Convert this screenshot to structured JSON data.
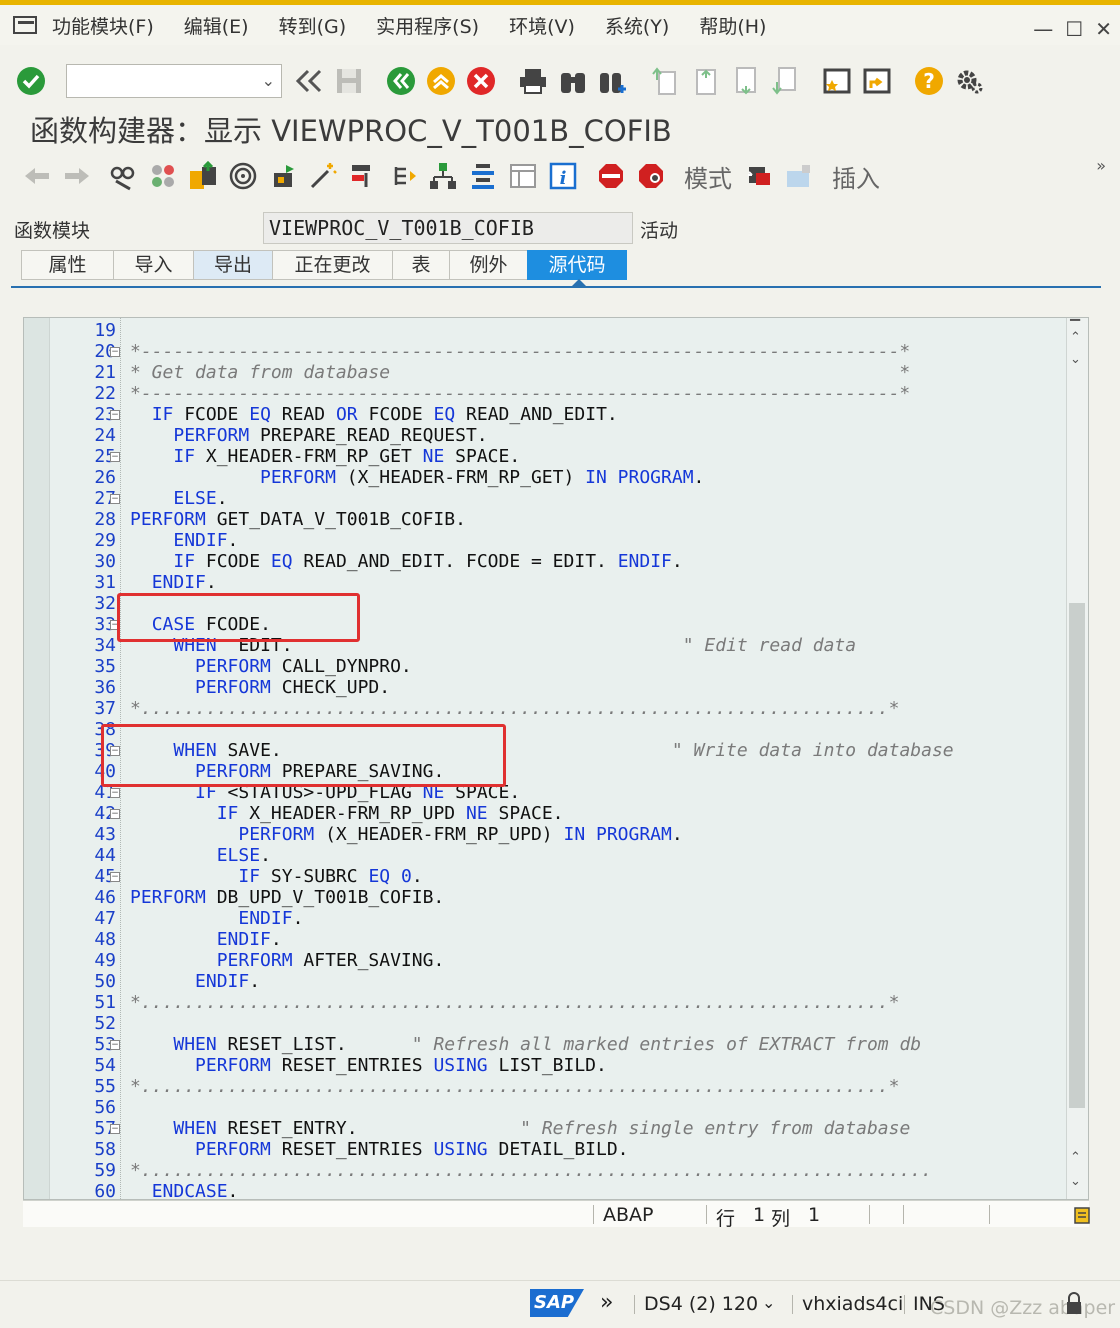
{
  "menu": {
    "items": [
      "功能模块(F)",
      "编辑(E)",
      "转到(G)",
      "实用程序(S)",
      "环境(V)",
      "系统(Y)",
      "帮助(H)"
    ],
    "window_controls": [
      "—",
      "☐",
      "✕"
    ]
  },
  "toolbar": {
    "command_field_value": "",
    "icons": [
      "enter-check-icon",
      "history-back-icon",
      "save-icon",
      "back-icon",
      "exit-icon",
      "cancel-icon",
      "print-icon",
      "find-icon",
      "find-next-icon",
      "first-page-icon",
      "prev-page-icon",
      "next-page-icon",
      "last-page-icon",
      "new-session-icon",
      "shortcut-icon",
      "help-icon",
      "settings-icon"
    ]
  },
  "page": {
    "title": "函数构建器：显示 VIEWPROC_V_T001B_COFIB"
  },
  "app_toolbar": {
    "mode_label": "模式",
    "insert_label": "插入",
    "more_label": "»"
  },
  "header": {
    "function_module_label": "函数模块",
    "function_module_value": "VIEWPROC_V_T001B_COFIB",
    "status": "活动"
  },
  "tabs": [
    {
      "label": "属性"
    },
    {
      "label": "导入"
    },
    {
      "label": "导出"
    },
    {
      "label": "正在更改"
    },
    {
      "label": "表"
    },
    {
      "label": "例外"
    },
    {
      "label": "源代码"
    }
  ],
  "editor": {
    "lines": [
      {
        "n": "19",
        "html": ""
      },
      {
        "n": "20",
        "html": "<span class='cm'>*----------------------------------------------------------------------*</span>"
      },
      {
        "n": "21",
        "html": "<span class='cm'>* Get data from database                                               *</span>"
      },
      {
        "n": "22",
        "html": "<span class='cm'>*----------------------------------------------------------------------*</span>"
      },
      {
        "n": "23",
        "html": "  <span class='kw'>IF</span> FCODE <span class='kw'>EQ</span> READ <span class='kw'>OR</span> FCODE <span class='kw'>EQ</span> READ_AND_EDIT."
      },
      {
        "n": "24",
        "html": "    <span class='kw'>PERFORM</span> PREPARE_READ_REQUEST."
      },
      {
        "n": "25",
        "html": "    <span class='kw'>IF</span> X_HEADER-FRM_RP_GET <span class='kw'>NE</span> SPACE."
      },
      {
        "n": "26",
        "html": "            <span class='kw'>PERFORM</span> (X_HEADER-FRM_RP_GET) <span class='kw'>IN PROGRAM</span>."
      },
      {
        "n": "27",
        "html": "    <span class='kw'>ELSE</span>."
      },
      {
        "n": "28",
        "html": "<span class='kw'>PERFORM</span> GET_DATA_V_T001B_COFIB."
      },
      {
        "n": "29",
        "html": "    <span class='kw'>ENDIF</span>."
      },
      {
        "n": "30",
        "html": "    <span class='kw'>IF</span> FCODE <span class='kw'>EQ</span> READ_AND_EDIT. FCODE = EDIT. <span class='kw'>ENDIF</span>."
      },
      {
        "n": "31",
        "html": "  <span class='kw'>ENDIF</span>."
      },
      {
        "n": "32",
        "html": ""
      },
      {
        "n": "33",
        "html": "  <span class='kw'>CASE</span> FCODE."
      },
      {
        "n": "34",
        "html": "    <span class='kw'>WHEN</span>  EDIT.                                    <span class='cm'>\" Edit read data</span>"
      },
      {
        "n": "35",
        "html": "      <span class='kw'>PERFORM</span> CALL_DYNPRO."
      },
      {
        "n": "36",
        "html": "      <span class='kw'>PERFORM</span> CHECK_UPD."
      },
      {
        "n": "37",
        "html": "<span class='cm'>*.....................................................................*</span>"
      },
      {
        "n": "38",
        "html": ""
      },
      {
        "n": "39",
        "html": "    <span class='kw'>WHEN</span> SAVE.                                    <span class='cm'>\" Write data into database</span>"
      },
      {
        "n": "40",
        "html": "      <span class='kw'>PERFORM</span> PREPARE_SAVING."
      },
      {
        "n": "41",
        "html": "      <span class='kw'>IF</span> &lt;STATUS&gt;-UPD_FLAG <span class='kw'>NE</span> SPACE."
      },
      {
        "n": "42",
        "html": "        <span class='kw'>IF</span> X_HEADER-FRM_RP_UPD <span class='kw'>NE</span> SPACE."
      },
      {
        "n": "43",
        "html": "          <span class='kw'>PERFORM</span> (X_HEADER-FRM_RP_UPD) <span class='kw'>IN PROGRAM</span>."
      },
      {
        "n": "44",
        "html": "        <span class='kw'>ELSE</span>."
      },
      {
        "n": "45",
        "html": "          <span class='kw'>IF</span> SY-SUBRC <span class='kw'>EQ</span> <span class='num'>0</span>."
      },
      {
        "n": "46",
        "html": "<span class='kw'>PERFORM</span> DB_UPD_V_T001B_COFIB."
      },
      {
        "n": "47",
        "html": "          <span class='kw'>ENDIF</span>."
      },
      {
        "n": "48",
        "html": "        <span class='kw'>ENDIF</span>."
      },
      {
        "n": "49",
        "html": "        <span class='kw'>PERFORM</span> AFTER_SAVING."
      },
      {
        "n": "50",
        "html": "      <span class='kw'>ENDIF</span>."
      },
      {
        "n": "51",
        "html": "<span class='cm'>*.....................................................................*</span>"
      },
      {
        "n": "52",
        "html": ""
      },
      {
        "n": "53",
        "html": "    <span class='kw'>WHEN</span> RESET_LIST.      <span class='cm'>\" Refresh all marked entries of EXTRACT from db</span>"
      },
      {
        "n": "54",
        "html": "      <span class='kw'>PERFORM</span> RESET_ENTRIES <span class='kw'>USING</span> LIST_BILD."
      },
      {
        "n": "55",
        "html": "<span class='cm'>*.....................................................................*</span>"
      },
      {
        "n": "56",
        "html": ""
      },
      {
        "n": "57",
        "html": "    <span class='kw'>WHEN</span> RESET_ENTRY.               <span class='cm'>\" Refresh single entry from database</span>"
      },
      {
        "n": "58",
        "html": "      <span class='kw'>PERFORM</span> RESET_ENTRIES <span class='kw'>USING</span> DETAIL_BILD."
      },
      {
        "n": "59",
        "html": "<span class='cm'>*.........................................................................</span>"
      },
      {
        "n": "60",
        "html": "  <span class='kw'>ENDCASE</span>."
      }
    ],
    "fold_lines": [
      "20",
      "23",
      "25",
      "27",
      "33",
      "39",
      "41",
      "42",
      "45",
      "53",
      "57"
    ]
  },
  "editor_status": {
    "language": "ABAP",
    "row_label": "行",
    "row_value": "1",
    "col_label": "列",
    "col_value": "1"
  },
  "statusbar": {
    "sap_logo": "SAP",
    "chevron": "»",
    "system": "DS4 (2) 120",
    "host": "vhxiads4ci",
    "mode": "INS",
    "watermark": "CSDN @Zzz abaper"
  }
}
